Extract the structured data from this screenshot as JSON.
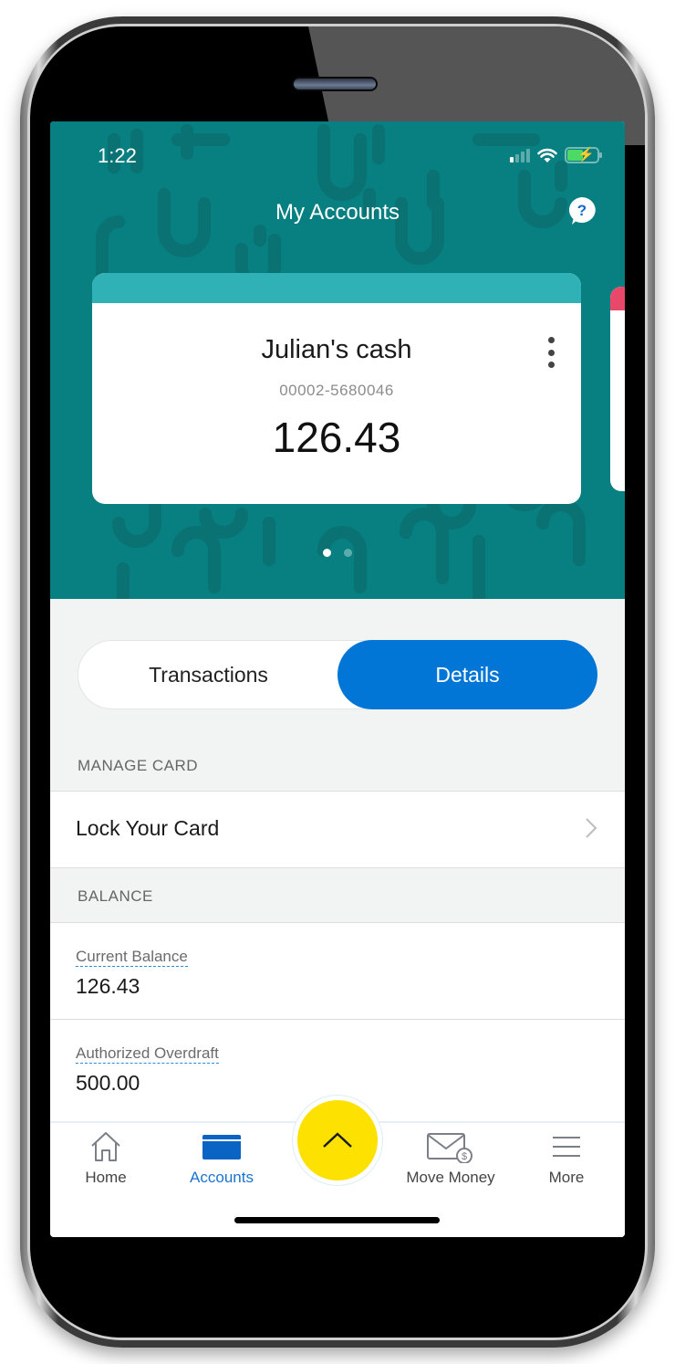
{
  "status_bar": {
    "time": "1:22"
  },
  "header": {
    "title": "My Accounts",
    "help_icon": "help-bubble-icon"
  },
  "colors": {
    "header_bg": "#087f80",
    "card_accent": "#2fb1b5",
    "next_card_accent": "#e8496a",
    "primary_blue": "#0276d7",
    "fab_yellow": "#fde100"
  },
  "account_card": {
    "name": "Julian's cash",
    "number": "00002-5680046",
    "balance": "126.43",
    "menu_icon": "more-vertical-icon"
  },
  "carousel": {
    "total": 2,
    "active_index": 0
  },
  "tabs": [
    {
      "label": "Transactions",
      "active": false
    },
    {
      "label": "Details",
      "active": true
    }
  ],
  "manage_card": {
    "section_title": "MANAGE CARD",
    "items": [
      {
        "label": "Lock Your Card"
      }
    ]
  },
  "balance": {
    "section_title": "BALANCE",
    "fields": [
      {
        "label": "Current Balance",
        "value": "126.43"
      },
      {
        "label": "Authorized Overdraft",
        "value": "500.00"
      }
    ]
  },
  "bottom_nav": {
    "items": [
      {
        "label": "Home",
        "icon": "home-icon",
        "active": false
      },
      {
        "label": "Accounts",
        "icon": "card-icon",
        "active": true
      },
      {
        "label": "Move Money",
        "icon": "envelope-dollar-icon",
        "active": false
      },
      {
        "label": "More",
        "icon": "menu-icon",
        "active": false
      }
    ],
    "fab_icon": "chevron-up-icon"
  }
}
